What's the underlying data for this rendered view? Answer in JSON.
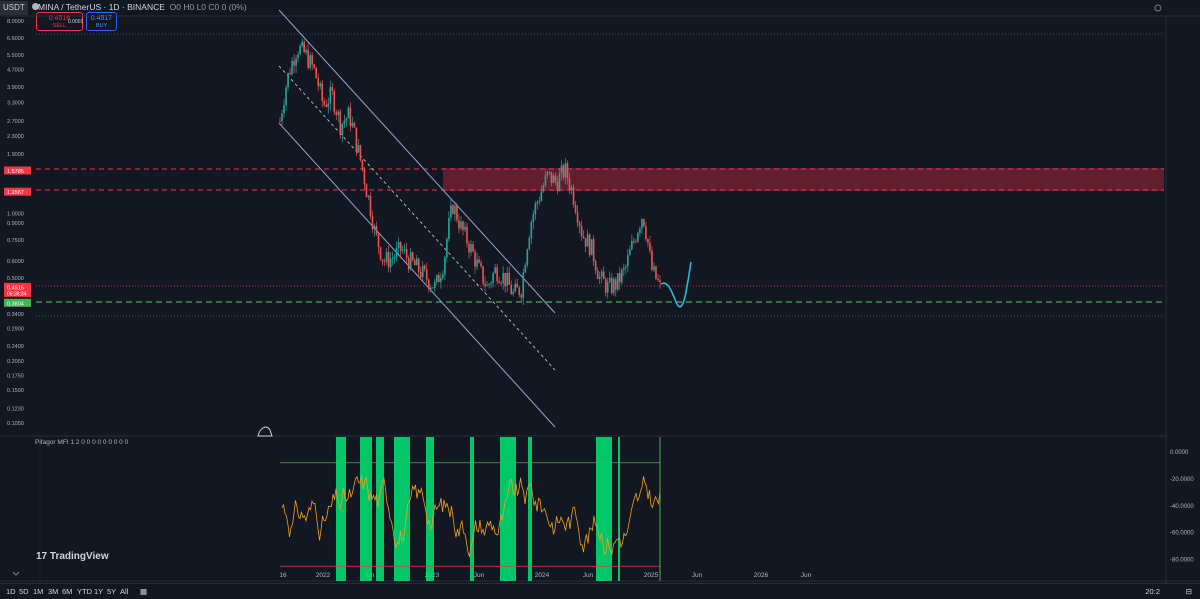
{
  "header": {
    "symbol_box": "USDT",
    "title": "MINA / TetherUS · 1D · BINANCE",
    "ohlc": "O0  H0  L0  C0  0 (0%)",
    "sell_price": "0.4516",
    "sell_label": "SELL",
    "buy_price": "0.4517",
    "buy_label": "BUY",
    "spread": "0.0001"
  },
  "oscillator": {
    "title": "Pifagor MFI 1.2  0 0 0 0 0 0 0 0 0"
  },
  "branding": {
    "logo_mark": "17",
    "logo_text": "TradingView"
  },
  "bottom_bar": {
    "timeframes": [
      "1D",
      "5D",
      "1M",
      "3M",
      "6M",
      "YTD",
      "1Y",
      "5Y",
      "All"
    ],
    "time_right": "20:2"
  },
  "colors": {
    "background": "#131722",
    "candle_up": "#26a69a",
    "candle_down": "#ef5350",
    "channel": "#8ba7d6",
    "resistance_zone": "#a0243a",
    "resistance_line": "#f23645",
    "support_line": "#4caf50",
    "projection": "#2bb8d6",
    "mfi_line": "#f0a020",
    "mfi_band": "#00e676"
  },
  "chart_data": [
    {
      "type": "line",
      "title": "MINA / TetherUS · 1D · BINANCE",
      "y_scale": "log",
      "ylim": [
        0.1,
        7.0
      ],
      "y_ticks": [
        "8.0000",
        "6.6000",
        "5.5000",
        "4.7000",
        "3.9000",
        "3.3000",
        "2.7000",
        "2.3000",
        "1.9000",
        "1.5785",
        "1.2567",
        "1.0000",
        "0.9000",
        "0.7500",
        "0.6000",
        "0.5000",
        "0.4516",
        "0.3804",
        "0.3400",
        "0.2900",
        "0.2400",
        "0.2050",
        "0.1750",
        "0.1500",
        "0.1230",
        "0.1050"
      ],
      "x_ticks": [
        "16",
        "2022",
        "Jun",
        "2023",
        "Jun",
        "2024",
        "Jun",
        "2025",
        "Jun",
        "2026",
        "Jun"
      ],
      "price_labels": {
        "resistance_top": "1.5785",
        "resistance_bottom": "1.2567",
        "last_price": "0.4516",
        "countdown": "06:38:34",
        "support": "0.3804"
      },
      "levels": {
        "resistance_zone": [
          1.2567,
          1.5785
        ],
        "support": 0.3804,
        "last_price": 0.4516
      },
      "series": [
        {
          "x": [
            "2021-06",
            "2021-07",
            "2021-08",
            "2021-09",
            "2021-10",
            "2021-11",
            "2021-12",
            "2022-01",
            "2022-02",
            "2022-03",
            "2022-04",
            "2022-05",
            "2022-06",
            "2022-07",
            "2022-08",
            "2022-09",
            "2022-10",
            "2022-11",
            "2022-12",
            "2023-01",
            "2023-02",
            "2023-03",
            "2023-04",
            "2023-05",
            "2023-06",
            "2023-07",
            "2023-08",
            "2023-09",
            "2023-10",
            "2023-11",
            "2023-12",
            "2024-01",
            "2024-02",
            "2024-03",
            "2024-04",
            "2024-05",
            "2024-06",
            "2024-07",
            "2024-08",
            "2024-09",
            "2024-10",
            "2024-11",
            "2024-12",
            "2025-01",
            "2025-02"
          ],
          "values": [
            2.7,
            4.5,
            6.0,
            5.5,
            4.6,
            3.2,
            3.6,
            2.6,
            2.9,
            2.0,
            1.3,
            0.8,
            0.6,
            0.62,
            0.68,
            0.6,
            0.55,
            0.5,
            0.45,
            0.6,
            1.1,
            0.85,
            0.7,
            0.55,
            0.45,
            0.55,
            0.5,
            0.42,
            0.45,
            0.9,
            1.2,
            1.5,
            1.4,
            1.6,
            1.2,
            0.8,
            0.7,
            0.5,
            0.45,
            0.47,
            0.55,
            0.75,
            1.0,
            0.55,
            0.45
          ]
        }
      ]
    },
    {
      "type": "line",
      "title": "Pifagor MFI 1.2",
      "ylim": [
        -90,
        0
      ],
      "y_ticks": [
        "0.0000",
        "-20.0000",
        "-40.0000",
        "-60.0000",
        "-80.0000"
      ],
      "bands": {
        "upper": -8,
        "lower": -85
      }
    }
  ]
}
